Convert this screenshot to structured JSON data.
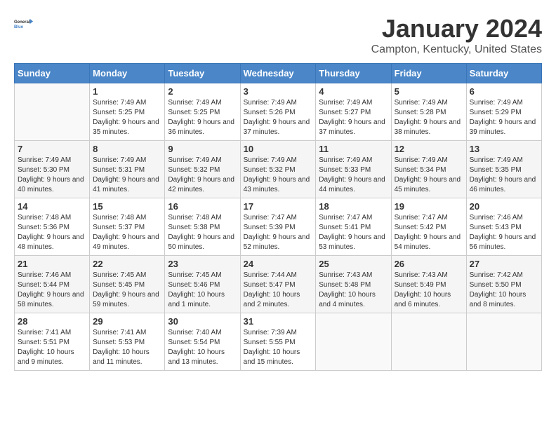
{
  "logo": {
    "line1": "General",
    "line2": "Blue"
  },
  "title": "January 2024",
  "subtitle": "Campton, Kentucky, United States",
  "days_of_week": [
    "Sunday",
    "Monday",
    "Tuesday",
    "Wednesday",
    "Thursday",
    "Friday",
    "Saturday"
  ],
  "weeks": [
    [
      {
        "day": "",
        "sunrise": "",
        "sunset": "",
        "daylight": ""
      },
      {
        "day": "1",
        "sunrise": "Sunrise: 7:49 AM",
        "sunset": "Sunset: 5:25 PM",
        "daylight": "Daylight: 9 hours and 35 minutes."
      },
      {
        "day": "2",
        "sunrise": "Sunrise: 7:49 AM",
        "sunset": "Sunset: 5:25 PM",
        "daylight": "Daylight: 9 hours and 36 minutes."
      },
      {
        "day": "3",
        "sunrise": "Sunrise: 7:49 AM",
        "sunset": "Sunset: 5:26 PM",
        "daylight": "Daylight: 9 hours and 37 minutes."
      },
      {
        "day": "4",
        "sunrise": "Sunrise: 7:49 AM",
        "sunset": "Sunset: 5:27 PM",
        "daylight": "Daylight: 9 hours and 37 minutes."
      },
      {
        "day": "5",
        "sunrise": "Sunrise: 7:49 AM",
        "sunset": "Sunset: 5:28 PM",
        "daylight": "Daylight: 9 hours and 38 minutes."
      },
      {
        "day": "6",
        "sunrise": "Sunrise: 7:49 AM",
        "sunset": "Sunset: 5:29 PM",
        "daylight": "Daylight: 9 hours and 39 minutes."
      }
    ],
    [
      {
        "day": "7",
        "sunrise": "Sunrise: 7:49 AM",
        "sunset": "Sunset: 5:30 PM",
        "daylight": "Daylight: 9 hours and 40 minutes."
      },
      {
        "day": "8",
        "sunrise": "Sunrise: 7:49 AM",
        "sunset": "Sunset: 5:31 PM",
        "daylight": "Daylight: 9 hours and 41 minutes."
      },
      {
        "day": "9",
        "sunrise": "Sunrise: 7:49 AM",
        "sunset": "Sunset: 5:32 PM",
        "daylight": "Daylight: 9 hours and 42 minutes."
      },
      {
        "day": "10",
        "sunrise": "Sunrise: 7:49 AM",
        "sunset": "Sunset: 5:32 PM",
        "daylight": "Daylight: 9 hours and 43 minutes."
      },
      {
        "day": "11",
        "sunrise": "Sunrise: 7:49 AM",
        "sunset": "Sunset: 5:33 PM",
        "daylight": "Daylight: 9 hours and 44 minutes."
      },
      {
        "day": "12",
        "sunrise": "Sunrise: 7:49 AM",
        "sunset": "Sunset: 5:34 PM",
        "daylight": "Daylight: 9 hours and 45 minutes."
      },
      {
        "day": "13",
        "sunrise": "Sunrise: 7:49 AM",
        "sunset": "Sunset: 5:35 PM",
        "daylight": "Daylight: 9 hours and 46 minutes."
      }
    ],
    [
      {
        "day": "14",
        "sunrise": "Sunrise: 7:48 AM",
        "sunset": "Sunset: 5:36 PM",
        "daylight": "Daylight: 9 hours and 48 minutes."
      },
      {
        "day": "15",
        "sunrise": "Sunrise: 7:48 AM",
        "sunset": "Sunset: 5:37 PM",
        "daylight": "Daylight: 9 hours and 49 minutes."
      },
      {
        "day": "16",
        "sunrise": "Sunrise: 7:48 AM",
        "sunset": "Sunset: 5:38 PM",
        "daylight": "Daylight: 9 hours and 50 minutes."
      },
      {
        "day": "17",
        "sunrise": "Sunrise: 7:47 AM",
        "sunset": "Sunset: 5:39 PM",
        "daylight": "Daylight: 9 hours and 52 minutes."
      },
      {
        "day": "18",
        "sunrise": "Sunrise: 7:47 AM",
        "sunset": "Sunset: 5:41 PM",
        "daylight": "Daylight: 9 hours and 53 minutes."
      },
      {
        "day": "19",
        "sunrise": "Sunrise: 7:47 AM",
        "sunset": "Sunset: 5:42 PM",
        "daylight": "Daylight: 9 hours and 54 minutes."
      },
      {
        "day": "20",
        "sunrise": "Sunrise: 7:46 AM",
        "sunset": "Sunset: 5:43 PM",
        "daylight": "Daylight: 9 hours and 56 minutes."
      }
    ],
    [
      {
        "day": "21",
        "sunrise": "Sunrise: 7:46 AM",
        "sunset": "Sunset: 5:44 PM",
        "daylight": "Daylight: 9 hours and 58 minutes."
      },
      {
        "day": "22",
        "sunrise": "Sunrise: 7:45 AM",
        "sunset": "Sunset: 5:45 PM",
        "daylight": "Daylight: 9 hours and 59 minutes."
      },
      {
        "day": "23",
        "sunrise": "Sunrise: 7:45 AM",
        "sunset": "Sunset: 5:46 PM",
        "daylight": "Daylight: 10 hours and 1 minute."
      },
      {
        "day": "24",
        "sunrise": "Sunrise: 7:44 AM",
        "sunset": "Sunset: 5:47 PM",
        "daylight": "Daylight: 10 hours and 2 minutes."
      },
      {
        "day": "25",
        "sunrise": "Sunrise: 7:43 AM",
        "sunset": "Sunset: 5:48 PM",
        "daylight": "Daylight: 10 hours and 4 minutes."
      },
      {
        "day": "26",
        "sunrise": "Sunrise: 7:43 AM",
        "sunset": "Sunset: 5:49 PM",
        "daylight": "Daylight: 10 hours and 6 minutes."
      },
      {
        "day": "27",
        "sunrise": "Sunrise: 7:42 AM",
        "sunset": "Sunset: 5:50 PM",
        "daylight": "Daylight: 10 hours and 8 minutes."
      }
    ],
    [
      {
        "day": "28",
        "sunrise": "Sunrise: 7:41 AM",
        "sunset": "Sunset: 5:51 PM",
        "daylight": "Daylight: 10 hours and 9 minutes."
      },
      {
        "day": "29",
        "sunrise": "Sunrise: 7:41 AM",
        "sunset": "Sunset: 5:53 PM",
        "daylight": "Daylight: 10 hours and 11 minutes."
      },
      {
        "day": "30",
        "sunrise": "Sunrise: 7:40 AM",
        "sunset": "Sunset: 5:54 PM",
        "daylight": "Daylight: 10 hours and 13 minutes."
      },
      {
        "day": "31",
        "sunrise": "Sunrise: 7:39 AM",
        "sunset": "Sunset: 5:55 PM",
        "daylight": "Daylight: 10 hours and 15 minutes."
      },
      {
        "day": "",
        "sunrise": "",
        "sunset": "",
        "daylight": ""
      },
      {
        "day": "",
        "sunrise": "",
        "sunset": "",
        "daylight": ""
      },
      {
        "day": "",
        "sunrise": "",
        "sunset": "",
        "daylight": ""
      }
    ]
  ]
}
